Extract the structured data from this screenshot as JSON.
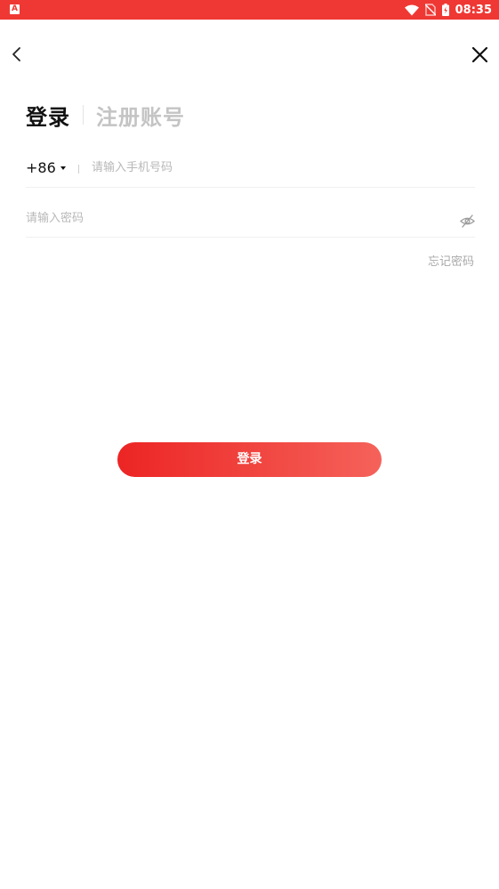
{
  "status_bar": {
    "app_icon_letter": "A",
    "time": "08:35"
  },
  "tabs": {
    "login": "登录",
    "register": "注册账号"
  },
  "phone": {
    "country_code": "+86",
    "placeholder": "请输入手机号码"
  },
  "password": {
    "placeholder": "请输入密码"
  },
  "forgot_password": "忘记密码",
  "login_button": "登录",
  "colors": {
    "status_bar": "#ef3834",
    "button_start": "#ec2524",
    "button_end": "#f5625a"
  }
}
